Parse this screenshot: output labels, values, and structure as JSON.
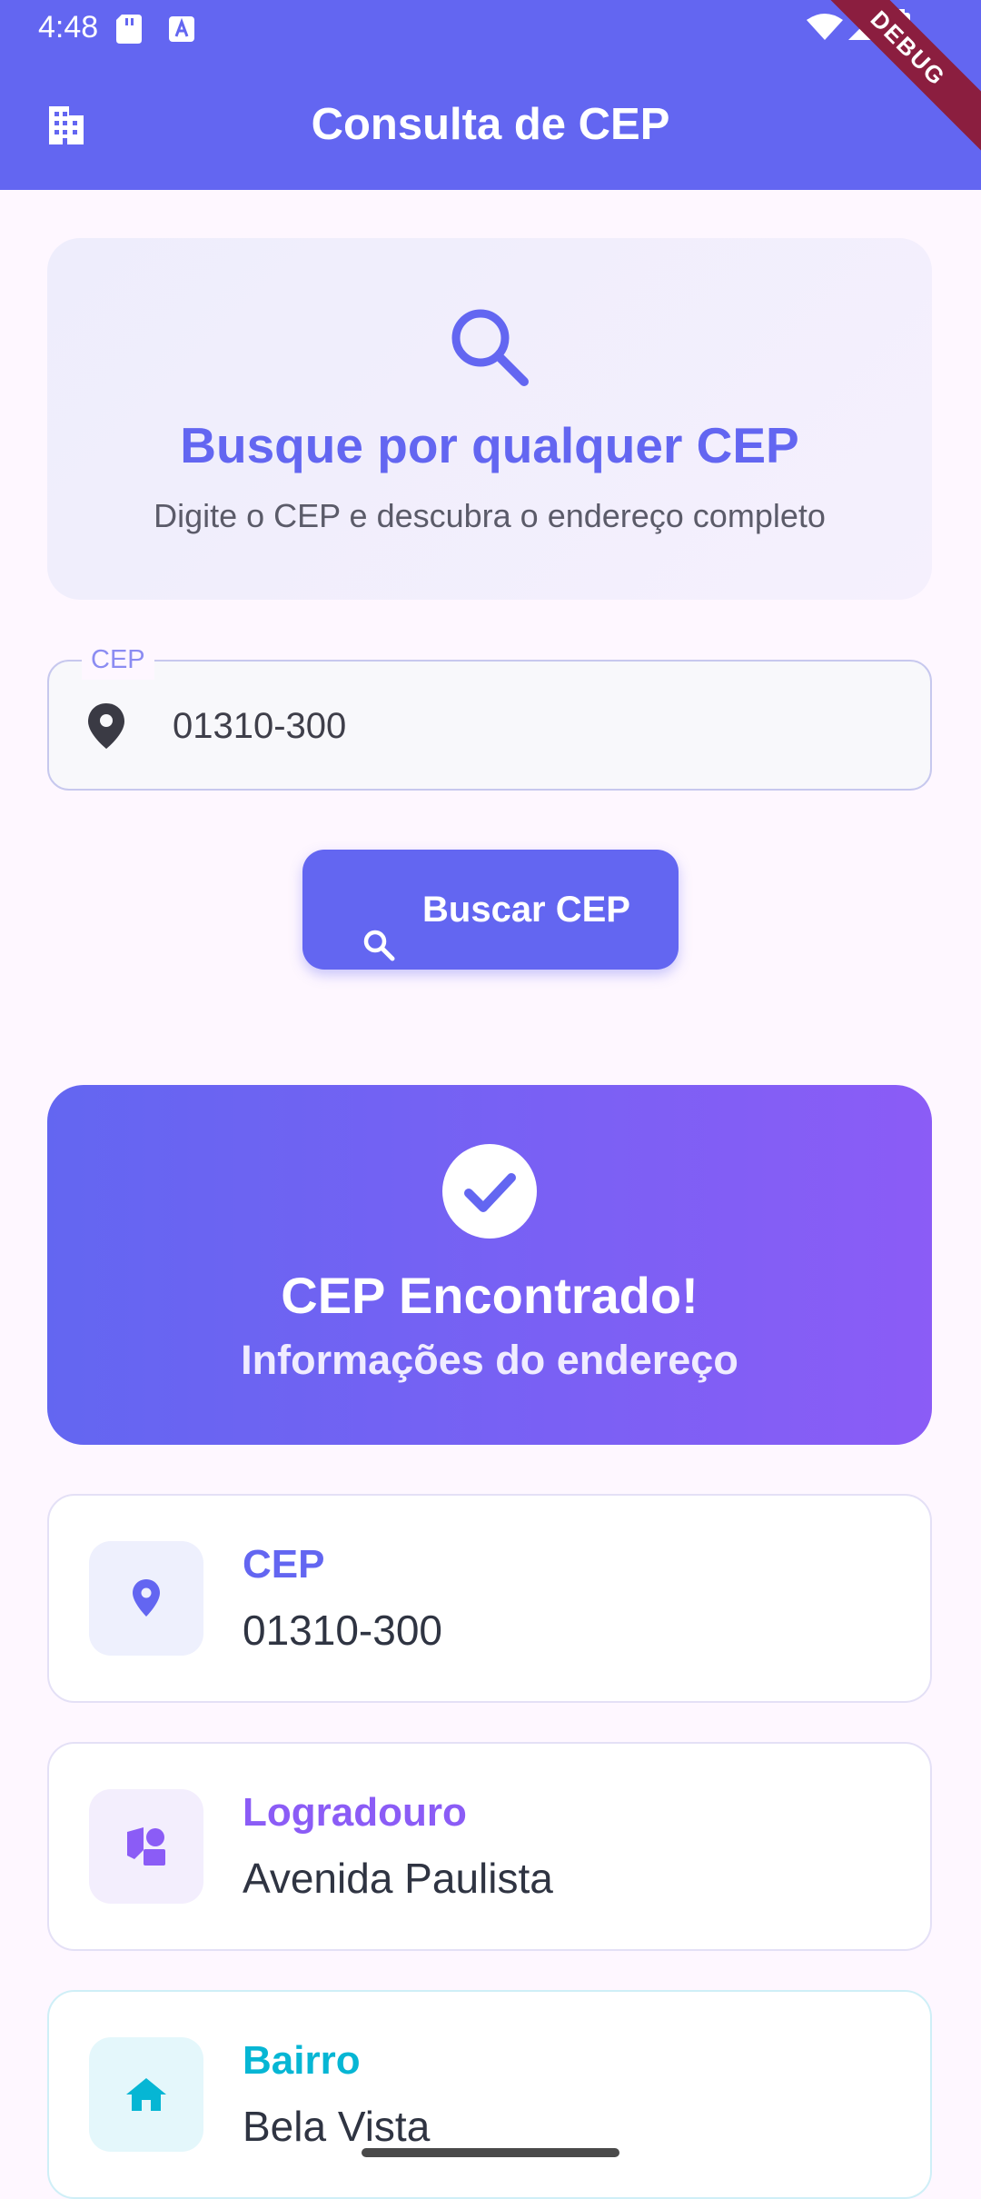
{
  "status_bar": {
    "time": "4:48"
  },
  "app_bar": {
    "title": "Consulta de CEP",
    "leading_icon": "building-icon",
    "debug_banner": "DEBUG"
  },
  "hero": {
    "icon": "search-icon",
    "title": "Busque por qualquer CEP",
    "subtitle": "Digite o CEP e descubra o endereço completo"
  },
  "cep_field": {
    "label": "CEP",
    "value": "01310-300",
    "icon": "location-pin-icon"
  },
  "search_button": {
    "label": "Buscar CEP",
    "icon": "search-icon"
  },
  "result": {
    "icon": "check-circle-icon",
    "title": "CEP Encontrado!",
    "subtitle": "Informações do endereço"
  },
  "info_cards": [
    {
      "label": "CEP",
      "value": "01310-300",
      "icon": "location-pin-icon",
      "color": "#6366F1",
      "tile_color": "#EEF0FD"
    },
    {
      "label": "Logradouro",
      "value": "Avenida Paulista",
      "icon": "shapes-icon",
      "color": "#8B5CF6",
      "tile_color": "#F3EEFD"
    },
    {
      "label": "Bairro",
      "value": "Bela Vista",
      "icon": "home-icon",
      "color": "#06B6D4",
      "tile_color": "#E4F7FB"
    }
  ],
  "colors": {
    "primary": "#6366F1",
    "secondary": "#8B5CF6",
    "accent_cyan": "#06B6D4",
    "background": "#FEF7FF"
  }
}
